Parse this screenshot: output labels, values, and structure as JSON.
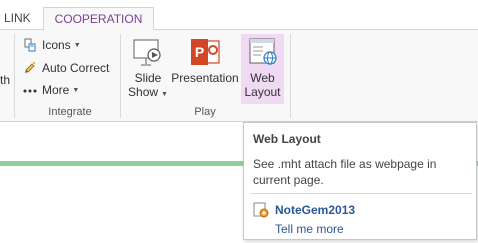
{
  "tabs": {
    "link": "LINK",
    "cooperation": "COOPERATION"
  },
  "ribbon": {
    "partial_label": "th",
    "integrate": {
      "icons_label": "Icons",
      "auto_correct_label": "Auto Correct",
      "more_label": "More",
      "group_label": "Integrate"
    },
    "play": {
      "slide_show_line1": "Slide",
      "slide_show_line2": "Show",
      "presentation_label": "Presentation",
      "web_layout_line1": "Web",
      "web_layout_line2": "Layout",
      "group_label": "Play"
    }
  },
  "tooltip": {
    "title": "Web Layout",
    "description": "See .mht attach file as webpage in current page.",
    "brand": "NoteGem2013",
    "tell_me_more": "Tell me more"
  },
  "colors": {
    "accent_tab": "#7b3f98",
    "active_button_bg": "#efd9f3",
    "green_line": "#92d09a",
    "link_blue": "#2b579a",
    "powerpoint_red": "#d24726"
  }
}
